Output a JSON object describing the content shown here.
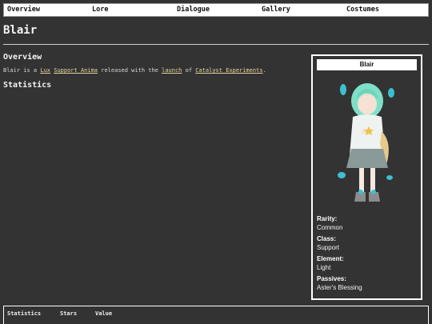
{
  "nav": {
    "items": [
      "Overview",
      "Lore",
      "Dialogue",
      "Gallery",
      "Costumes"
    ]
  },
  "page": {
    "title": "Blair"
  },
  "overview": {
    "heading": "Overview",
    "intro_prefix": "Blair is a ",
    "link_lux": "Lux",
    "link_support_anima": "Support Anima",
    "mid_text": " released with the ",
    "link_launch": "launch",
    "of_text": " of ",
    "link_catalyst": "Catalyst Experiments",
    "suffix": "."
  },
  "statistics": {
    "heading": "Statistics",
    "columns": [
      "Statistics",
      "Stars",
      "Value"
    ]
  },
  "infobox": {
    "name": "Blair",
    "fields": [
      {
        "label": "Rarity:",
        "value": "Common"
      },
      {
        "label": "Class:",
        "value": "Support"
      },
      {
        "label": "Element:",
        "value": "Light"
      },
      {
        "label": "Passives:",
        "value": "Aster's Blessing"
      }
    ]
  },
  "colors": {
    "background": "#333333",
    "link": "#e8d79a",
    "hair": "#7fe0c8",
    "accent": "#3cc0d0"
  }
}
